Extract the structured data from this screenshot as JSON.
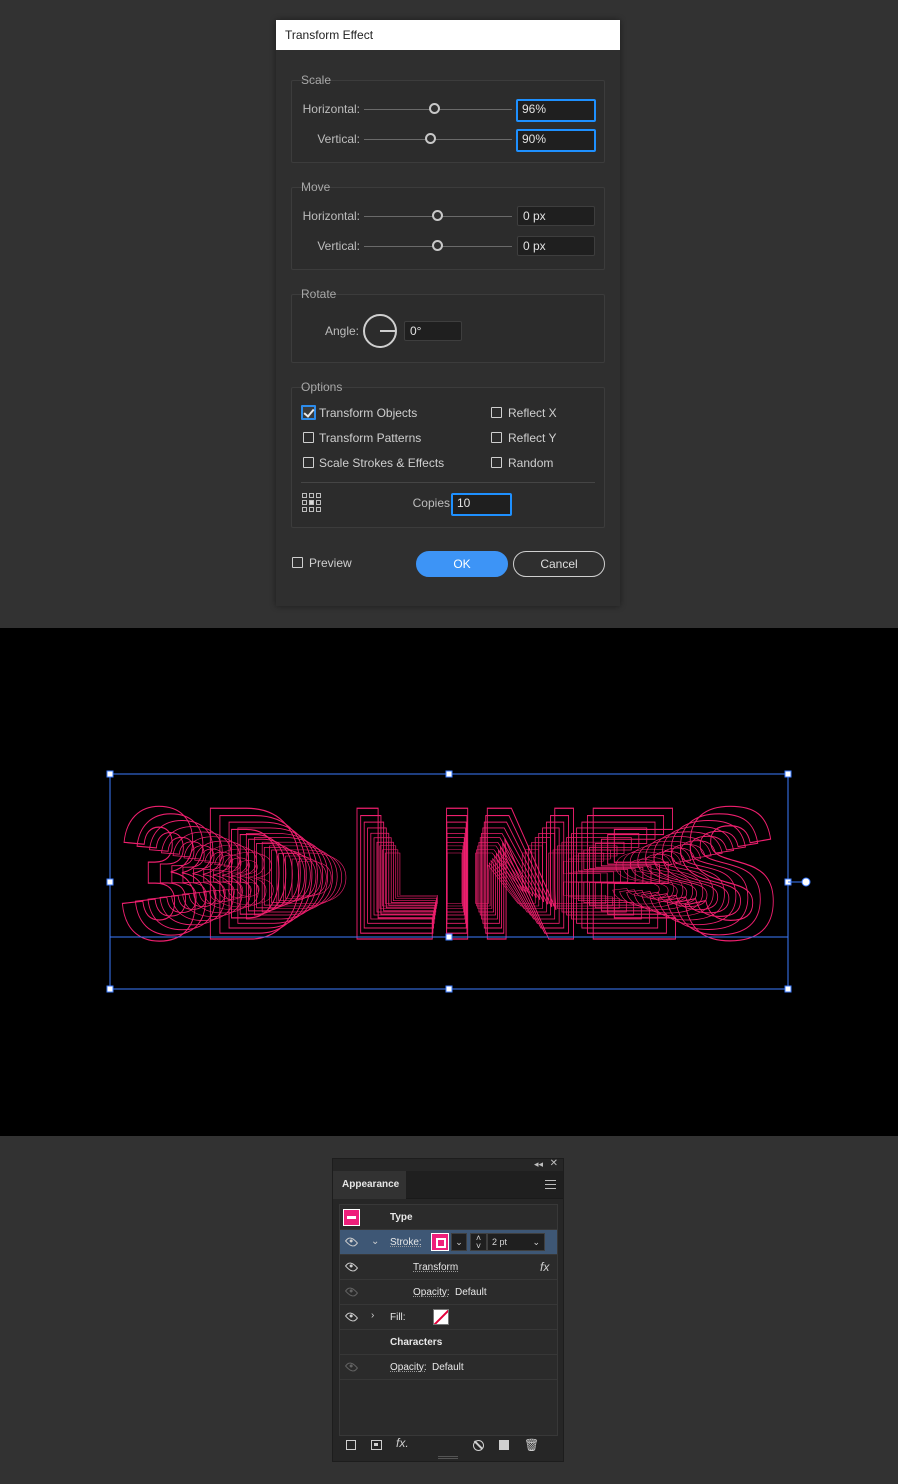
{
  "dialog": {
    "title": "Transform Effect",
    "scale": {
      "title": "Scale",
      "horizontal_label": "Horizontal:",
      "horizontal_value": "96%",
      "vertical_label": "Vertical:",
      "vertical_value": "90%"
    },
    "move": {
      "title": "Move",
      "horizontal_label": "Horizontal:",
      "horizontal_value": "0 px",
      "vertical_label": "Vertical:",
      "vertical_value": "0 px"
    },
    "rotate": {
      "title": "Rotate",
      "angle_label": "Angle:",
      "angle_value": "0°"
    },
    "options": {
      "title": "Options",
      "transform_objects": "Transform Objects",
      "transform_patterns": "Transform Patterns",
      "scale_strokes": "Scale Strokes & Effects",
      "reflect_x": "Reflect X",
      "reflect_y": "Reflect Y",
      "random": "Random",
      "copies_label": "Copies",
      "copies_value": "10"
    },
    "preview_label": "Preview",
    "ok_label": "OK",
    "cancel_label": "Cancel"
  },
  "artwork": {
    "text": "3D LINES",
    "stroke_color": "#ee1f6e",
    "selection_color": "#3b7bff"
  },
  "appearance": {
    "tab_label": "Appearance",
    "rows": {
      "type": "Type",
      "stroke_label": "Stroke:",
      "stroke_weight": "2 pt",
      "transform": "Transform",
      "fx": "fx",
      "opacity_label_1": "Opacity:",
      "opacity_value_1": "Default",
      "fill_label": "Fill:",
      "characters": "Characters",
      "opacity_label_2": "Opacity:",
      "opacity_value_2": "Default"
    },
    "bottom_fx": "fx."
  },
  "colors": {
    "accent_blue": "#3d94f6",
    "pink": "#ee1f7a"
  }
}
